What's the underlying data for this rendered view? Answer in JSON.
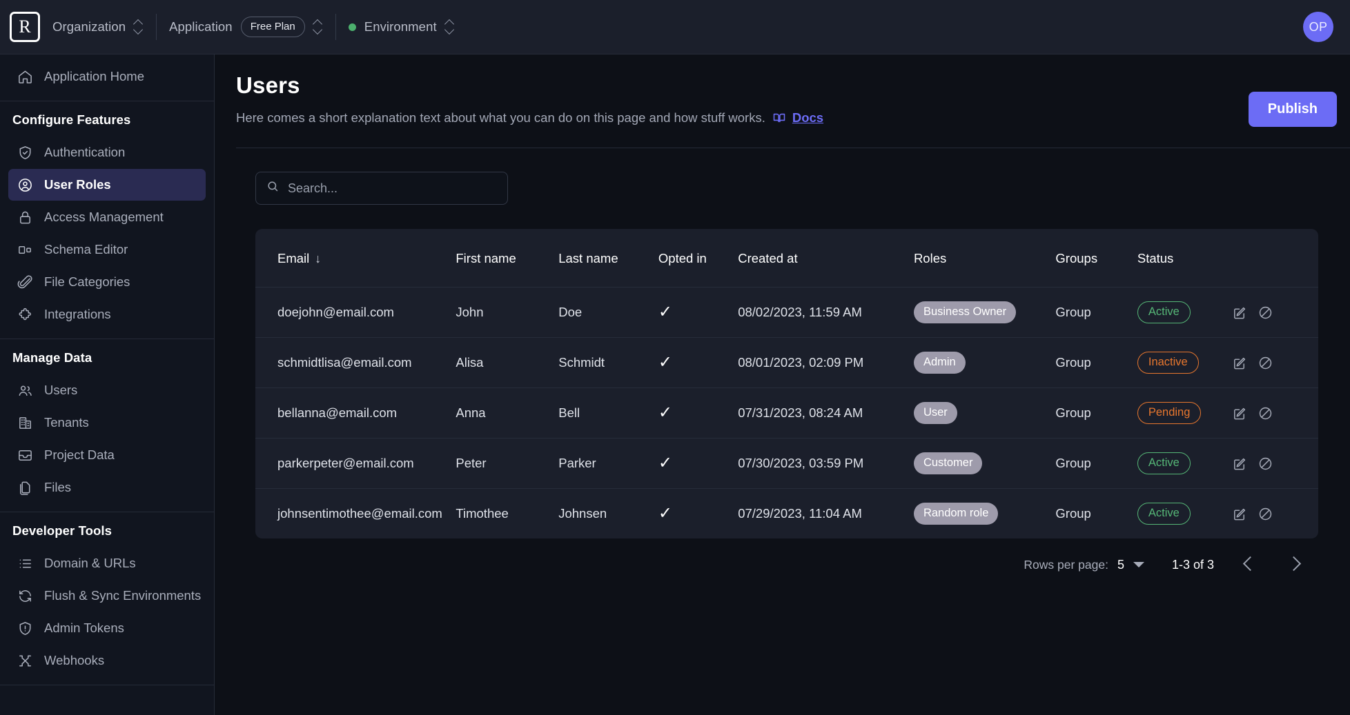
{
  "topbar": {
    "logo_letter": "R",
    "organization_label": "Organization",
    "application_label": "Application",
    "plan_badge": "Free Plan",
    "environment_label": "Environment",
    "environment_status_color": "#4caf6d",
    "avatar_initials": "OP"
  },
  "sidebar": {
    "home": {
      "label": "Application Home",
      "icon": "home-icon"
    },
    "sections": [
      {
        "heading": "Configure Features",
        "items": [
          {
            "label": "Authentication",
            "icon": "shield-check-icon",
            "active": false
          },
          {
            "label": "User Roles",
            "icon": "user-circle-icon",
            "active": true
          },
          {
            "label": "Access Management",
            "icon": "lock-icon",
            "active": false
          },
          {
            "label": "Schema Editor",
            "icon": "schema-icon",
            "active": false
          },
          {
            "label": "File Categories",
            "icon": "paperclip-icon",
            "active": false
          },
          {
            "label": "Integrations",
            "icon": "puzzle-icon",
            "active": false
          }
        ]
      },
      {
        "heading": "Manage Data",
        "items": [
          {
            "label": "Users",
            "icon": "users-icon",
            "active": false
          },
          {
            "label": "Tenants",
            "icon": "building-icon",
            "active": false
          },
          {
            "label": "Project Data",
            "icon": "archive-icon",
            "active": false
          },
          {
            "label": "Files",
            "icon": "files-icon",
            "active": false
          }
        ]
      },
      {
        "heading": "Developer Tools",
        "items": [
          {
            "label": "Domain & URLs",
            "icon": "list-icon",
            "active": false
          },
          {
            "label": "Flush & Sync Environments",
            "icon": "refresh-icon",
            "active": false
          },
          {
            "label": "Admin Tokens",
            "icon": "shield-alert-icon",
            "active": false
          },
          {
            "label": "Webhooks",
            "icon": "webhook-icon",
            "active": false
          }
        ]
      }
    ]
  },
  "page": {
    "title": "Users",
    "description": "Here comes a short explanation text about what you can do on this page and how stuff works.",
    "docs_label": "Docs",
    "publish_label": "Publish",
    "accent_color": "#6c6cf5"
  },
  "search": {
    "value": "",
    "placeholder": "Search..."
  },
  "table": {
    "columns": [
      {
        "key": "email",
        "label": "Email",
        "sorted": "desc"
      },
      {
        "key": "first_name",
        "label": "First name"
      },
      {
        "key": "last_name",
        "label": "Last name"
      },
      {
        "key": "opted_in",
        "label": "Opted in"
      },
      {
        "key": "created_at",
        "label": "Created at"
      },
      {
        "key": "roles",
        "label": "Roles"
      },
      {
        "key": "groups",
        "label": "Groups"
      },
      {
        "key": "status",
        "label": "Status"
      }
    ],
    "sort_arrow_glyph": "↓",
    "check_glyph": "✓",
    "rows": [
      {
        "email": "doejohn@email.com",
        "first_name": "John",
        "last_name": "Doe",
        "opted_in": true,
        "created_at": "08/02/2023, 11:59 AM",
        "role": "Business Owner",
        "group": "Group",
        "status": "Active"
      },
      {
        "email": "schmidtlisa@email.com",
        "first_name": "Alisa",
        "last_name": "Schmidt",
        "opted_in": true,
        "created_at": "08/01/2023, 02:09 PM",
        "role": "Admin",
        "group": "Group",
        "status": "Inactive"
      },
      {
        "email": "bellanna@email.com",
        "first_name": "Anna",
        "last_name": "Bell",
        "opted_in": true,
        "created_at": "07/31/2023, 08:24 AM",
        "role": "User",
        "group": "Group",
        "status": "Pending"
      },
      {
        "email": "parkerpeter@email.com",
        "first_name": "Peter",
        "last_name": "Parker",
        "opted_in": true,
        "created_at": "07/30/2023, 03:59 PM",
        "role": "Customer",
        "group": "Group",
        "status": "Active"
      },
      {
        "email": "johnsentimothee@email.com",
        "first_name": "Timothee",
        "last_name": "Johnsen",
        "opted_in": true,
        "created_at": "07/29/2023, 11:04 AM",
        "role": "Random role",
        "group": "Group",
        "status": "Active"
      }
    ],
    "status_colors": {
      "Active": "#56b777",
      "Inactive": "#e8772e",
      "Pending": "#e8772e"
    },
    "role_chip_color": "#9e9bab"
  },
  "pagination": {
    "rows_per_page_label": "Rows per page:",
    "rows_per_page_value": "5",
    "range_label": "1-3 of 3"
  }
}
